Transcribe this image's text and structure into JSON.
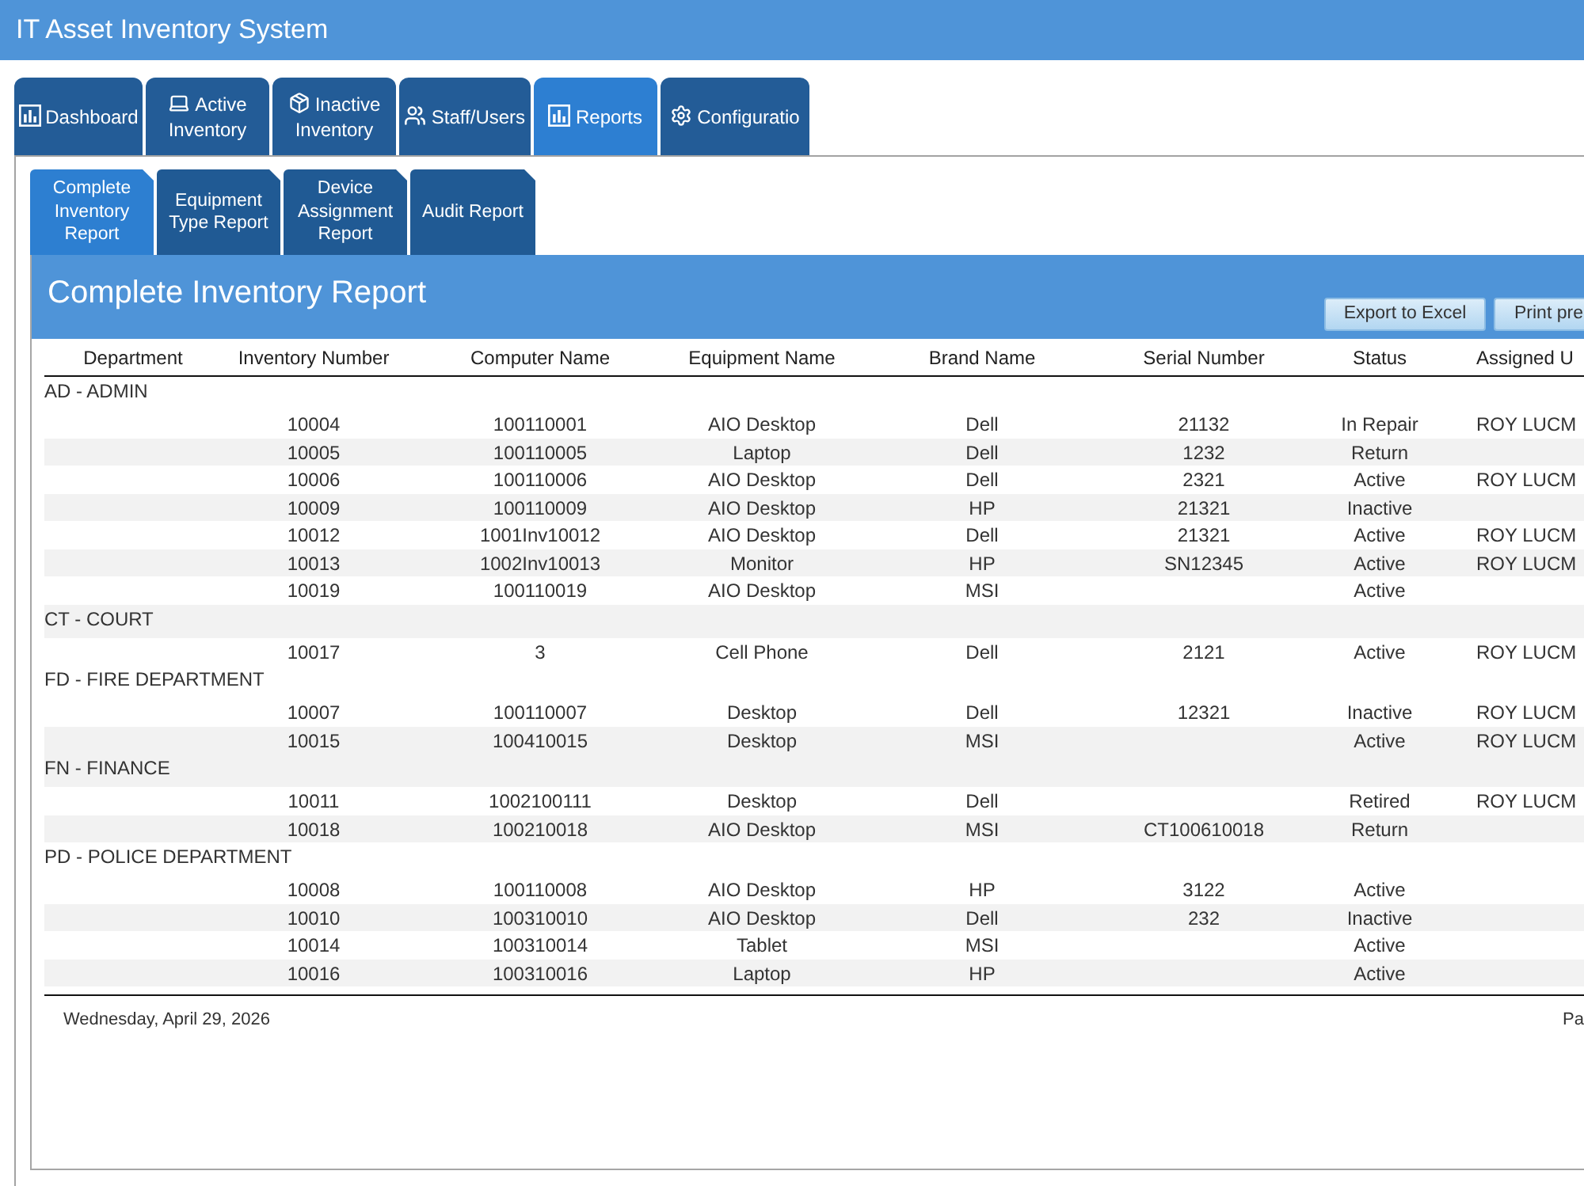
{
  "app": {
    "title": "IT Asset Inventory System"
  },
  "tabs": [
    {
      "label": "Dashboard",
      "selected": false
    },
    {
      "label": "Active Inventory",
      "selected": false
    },
    {
      "label": "Inactive Inventory",
      "selected": false
    },
    {
      "label": "Staff/Users",
      "selected": false
    },
    {
      "label": "Reports",
      "selected": true
    },
    {
      "label": "Configuratio",
      "selected": false
    }
  ],
  "report_tabs": [
    {
      "label": "Complete Inventory Report",
      "selected": true
    },
    {
      "label": "Equipment Type Report",
      "selected": false
    },
    {
      "label": "Device Assignment Report",
      "selected": false
    },
    {
      "label": "Audit Report",
      "selected": false
    }
  ],
  "report": {
    "title": "Complete Inventory Report",
    "buttons": [
      "Export to Excel",
      "Print pre"
    ]
  },
  "table": {
    "columns": [
      "Department",
      "Inventory Number",
      "Computer Name",
      "Equipment Name",
      "Brand Name",
      "Serial Number",
      "Status",
      "Assigned U"
    ],
    "groups": [
      {
        "department": "AD - ADMIN",
        "rows": [
          {
            "inventory_number": "10004",
            "computer_name": "100110001",
            "equipment_name": "AIO Desktop",
            "brand_name": "Dell",
            "serial_number": "21132",
            "status": "In Repair",
            "column_8": "ROY LUCM"
          },
          {
            "inventory_number": "10005",
            "computer_name": "100110005",
            "equipment_name": "Laptop",
            "brand_name": "Dell",
            "serial_number": "1232",
            "status": "Return"
          },
          {
            "inventory_number": "10006",
            "computer_name": "100110006",
            "equipment_name": "AIO Desktop",
            "brand_name": "Dell",
            "serial_number": "2321",
            "status": "Active",
            "column_8": "ROY LUCM"
          },
          {
            "inventory_number": "10009",
            "computer_name": "100110009",
            "equipment_name": "AIO Desktop",
            "brand_name": "HP",
            "serial_number": "21321",
            "status": "Inactive"
          },
          {
            "inventory_number": "10012",
            "computer_name": "1001Inv10012",
            "equipment_name": "AIO Desktop",
            "brand_name": "Dell",
            "serial_number": "21321",
            "status": "Active",
            "column_8": "ROY LUCM"
          },
          {
            "inventory_number": "10013",
            "computer_name": "1002Inv10013",
            "equipment_name": "Monitor",
            "brand_name": "HP",
            "serial_number": "SN12345",
            "status": "Active",
            "column_8": "ROY LUCM"
          },
          {
            "inventory_number": "10019",
            "computer_name": "100110019",
            "equipment_name": "AIO Desktop",
            "brand_name": "MSI",
            "status": "Active"
          }
        ]
      },
      {
        "department": "CT - COURT",
        "rows": [
          {
            "inventory_number": "10017",
            "computer_name": "3",
            "equipment_name": "Cell Phone",
            "brand_name": "Dell",
            "serial_number": "2121",
            "status": "Active",
            "column_8": "ROY LUCM"
          }
        ]
      },
      {
        "department": "FD - FIRE DEPARTMENT",
        "rows": [
          {
            "inventory_number": "10007",
            "computer_name": "100110007",
            "equipment_name": "Desktop",
            "brand_name": "Dell",
            "serial_number": "12321",
            "status": "Inactive",
            "column_8": "ROY LUCM"
          },
          {
            "inventory_number": "10015",
            "computer_name": "100410015",
            "equipment_name": "Desktop",
            "brand_name": "MSI",
            "status": "Active",
            "column_8": "ROY LUCM"
          }
        ]
      },
      {
        "department": "FN - FINANCE",
        "rows": [
          {
            "inventory_number": "10011",
            "computer_name": "1002100111",
            "equipment_name": "Desktop",
            "brand_name": "Dell",
            "status": "Retired",
            "column_8": "ROY LUCM"
          },
          {
            "inventory_number": "10018",
            "computer_name": "100210018",
            "equipment_name": "AIO Desktop",
            "brand_name": "MSI",
            "serial_number": "CT100610018",
            "status": "Return"
          }
        ]
      },
      {
        "department": "PD - POLICE DEPARTMENT",
        "rows": [
          {
            "inventory_number": "10008",
            "computer_name": "100110008",
            "equipment_name": "AIO Desktop",
            "brand_name": "HP",
            "serial_number": "3122",
            "status": "Active"
          },
          {
            "inventory_number": "10010",
            "computer_name": "100310010",
            "equipment_name": "AIO Desktop",
            "brand_name": "Dell",
            "serial_number": "232",
            "status": "Inactive"
          },
          {
            "inventory_number": "10014",
            "computer_name": "100310014",
            "equipment_name": "Tablet",
            "brand_name": "MSI",
            "status": "Active"
          },
          {
            "inventory_number": "10016",
            "computer_name": "100310016",
            "equipment_name": "Laptop",
            "brand_name": "HP",
            "status": "Active"
          }
        ]
      }
    ]
  },
  "footer": {
    "date": "Wednesday, April 29, 2026",
    "page": "Pa"
  }
}
